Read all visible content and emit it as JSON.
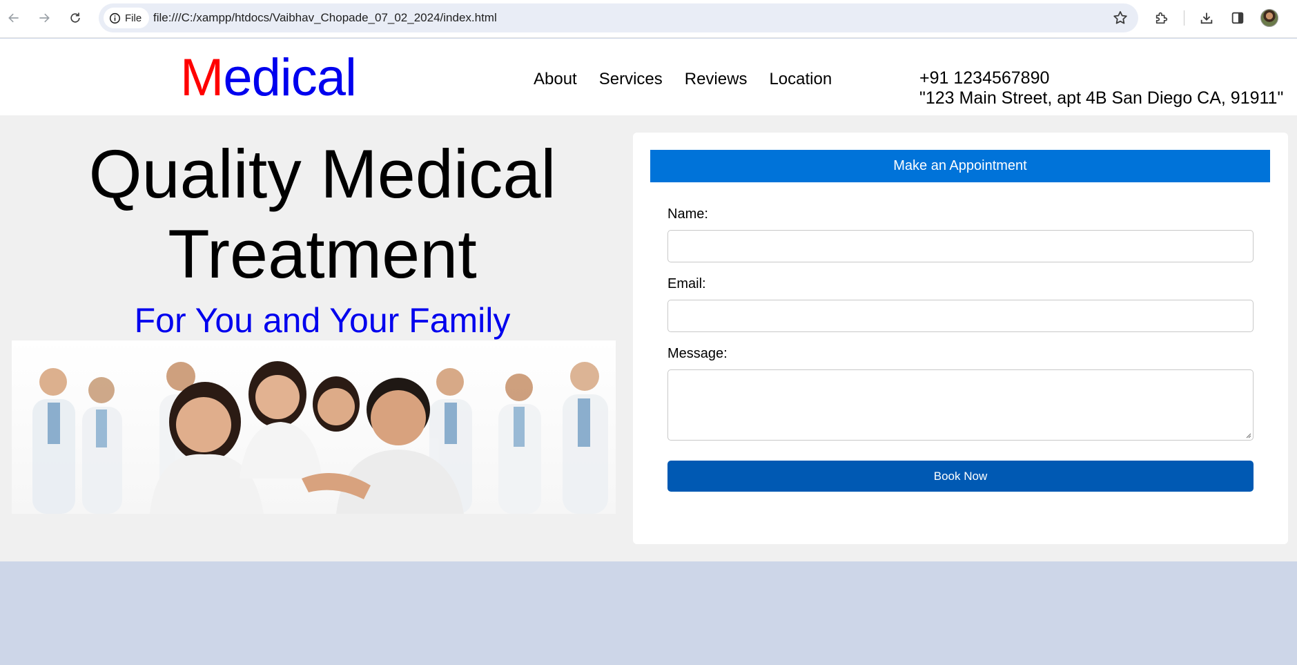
{
  "browser": {
    "chip_label": "File",
    "url": "file:///C:/xampp/htdocs/Vaibhav_Chopade_07_02_2024/index.html"
  },
  "header": {
    "logo_first": "M",
    "logo_rest": "edical",
    "nav": [
      {
        "label": "About"
      },
      {
        "label": "Services"
      },
      {
        "label": "Reviews"
      },
      {
        "label": "Location"
      }
    ],
    "phone": "+91 1234567890",
    "address": "\"123 Main Street, apt 4B San Diego CA, 91911\""
  },
  "hero": {
    "title_line1": "Quality Medical",
    "title_line2": "Treatment",
    "subtitle": "For You and Your Family"
  },
  "appointment": {
    "heading": "Make an Appointment",
    "name_label": "Name:",
    "name_value": "",
    "email_label": "Email:",
    "email_value": "",
    "message_label": "Message:",
    "message_value": "",
    "submit_label": "Book Now"
  },
  "colors": {
    "logo_first": "#ff0000",
    "logo_rest": "#0000ee",
    "panel_header": "#0073d9",
    "button": "#0059b3",
    "page_bg": "#f0f0f0",
    "footer_bg": "#cdd6e8"
  }
}
